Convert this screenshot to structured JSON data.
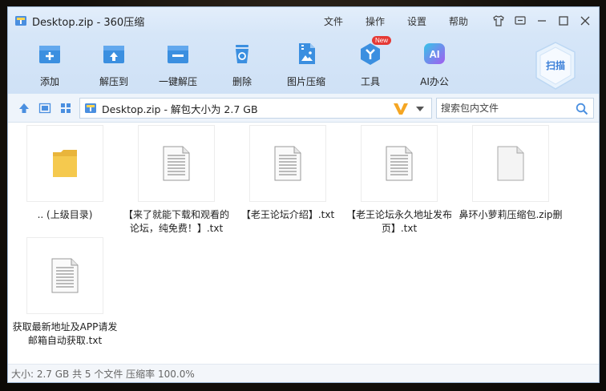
{
  "window": {
    "title": "Desktop.zip - 360压缩"
  },
  "menu": [
    "文件",
    "操作",
    "设置",
    "帮助"
  ],
  "toolbar": {
    "items": [
      {
        "label": "添加",
        "icon": "add-icon"
      },
      {
        "label": "解压到",
        "icon": "extract-to-icon"
      },
      {
        "label": "一键解压",
        "icon": "one-click-extract-icon"
      },
      {
        "label": "删除",
        "icon": "delete-icon"
      },
      {
        "label": "图片压缩",
        "icon": "image-compress-icon"
      },
      {
        "label": "工具",
        "icon": "tools-icon",
        "badge": "New"
      },
      {
        "label": "AI办公",
        "icon": "ai-office-icon",
        "icon_text": "AI"
      }
    ],
    "scan_label": "扫描"
  },
  "address": {
    "path": "Desktop.zip - 解包大小为 2.7 GB",
    "search_placeholder": "搜索包内文件"
  },
  "files": [
    {
      "name": ".. (上级目录)",
      "type": "folder"
    },
    {
      "name": "【来了就能下载和观看的论坛，纯免费！】.txt",
      "type": "text"
    },
    {
      "name": "【老王论坛介绍】.txt",
      "type": "text"
    },
    {
      "name": "【老王论坛永久地址发布页】.txt",
      "type": "text"
    },
    {
      "name": "鼻环小萝莉压缩包.zip删",
      "type": "blank"
    },
    {
      "name": "获取最新地址及APP请发邮箱自动获取.txt",
      "type": "text"
    }
  ],
  "status": {
    "text": "大小: 2.7 GB 共 5 个文件 压缩率 100.0%"
  },
  "colors": {
    "accent": "#3b8fe0",
    "titlebar": "#dbe8f8",
    "folder": "#f5c94e"
  }
}
